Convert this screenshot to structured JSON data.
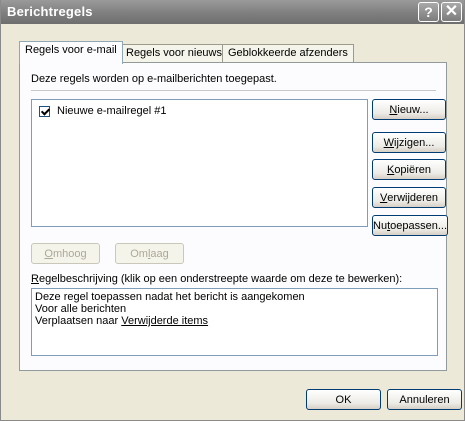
{
  "window": {
    "title": "Berichtregels",
    "help_glyph": "?",
    "close_glyph": "✕"
  },
  "tabs": [
    {
      "label": "Regels voor e-mail",
      "active": true
    },
    {
      "label": "Regels voor nieuws",
      "active": false
    },
    {
      "label": "Geblokkeerde afzenders",
      "active": false
    }
  ],
  "panel": {
    "intro": "Deze regels worden op e-mailberichten toegepast.",
    "rules": [
      {
        "label": "Nieuwe e-mailregel #1",
        "checked": true
      }
    ],
    "buttons": {
      "new": {
        "pre": "",
        "key": "N",
        "post": "ieuw..."
      },
      "edit": {
        "pre": "",
        "key": "W",
        "post": "ijzigen..."
      },
      "copy": {
        "pre": "",
        "key": "K",
        "post": "opiëren"
      },
      "remove": {
        "pre": "",
        "key": "V",
        "post": "erwijderen"
      },
      "apply": {
        "pre": "Nu ",
        "key": "t",
        "post": "oepassen..."
      },
      "up": {
        "pre": "",
        "key": "O",
        "post": "mhoog"
      },
      "down": {
        "pre": "Om",
        "key": "l",
        "post": "aag"
      }
    },
    "description_label": {
      "key": "R",
      "rest": "egelbeschrijving (klik op een onderstreepte waarde om deze te bewerken):"
    },
    "description": {
      "line1": "Deze regel toepassen nadat het bericht is aangekomen",
      "line2": "Voor alle berichten",
      "line3_prefix": "Verplaatsen naar ",
      "line3_link": "Verwijderde items"
    }
  },
  "footer": {
    "ok_label": "OK",
    "cancel_label": "Annuleren"
  }
}
